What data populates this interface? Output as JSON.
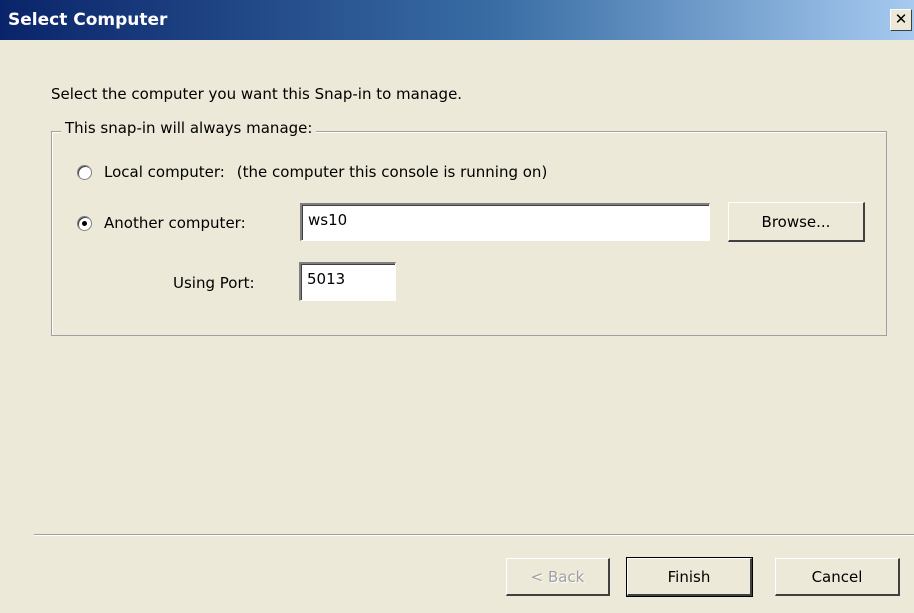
{
  "window": {
    "title": "Select Computer",
    "close_glyph": "✕"
  },
  "instruction": "Select the computer you want this Snap-in to manage.",
  "group": {
    "legend": "This snap-in will always manage:",
    "local_radio": {
      "label": "Local computer:",
      "description": "(the computer this console is running on)",
      "selected": false
    },
    "another_radio": {
      "label": "Another computer:",
      "selected": true
    },
    "computer_name": "ws10",
    "browse_label": "Browse...",
    "port_label": "Using Port:",
    "port_value": "5013"
  },
  "footer": {
    "back_label": "< Back",
    "finish_label": "Finish",
    "cancel_label": "Cancel"
  }
}
